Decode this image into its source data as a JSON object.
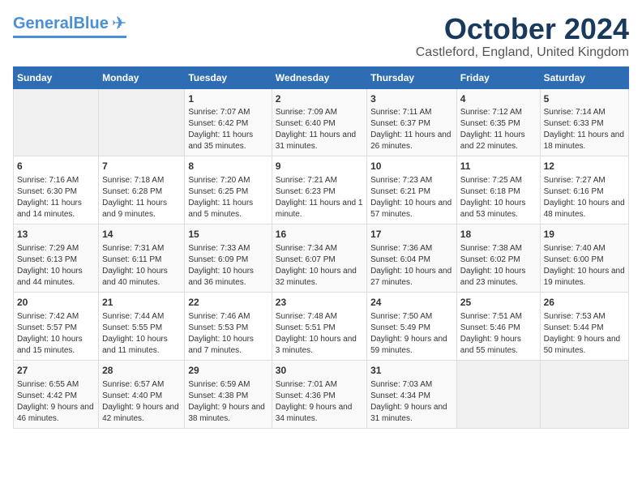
{
  "header": {
    "logo_general": "General",
    "logo_blue": "Blue",
    "month_title": "October 2024",
    "location": "Castleford, England, United Kingdom"
  },
  "days_of_week": [
    "Sunday",
    "Monday",
    "Tuesday",
    "Wednesday",
    "Thursday",
    "Friday",
    "Saturday"
  ],
  "weeks": [
    [
      {
        "day": "",
        "info": ""
      },
      {
        "day": "",
        "info": ""
      },
      {
        "day": "1",
        "info": "Sunrise: 7:07 AM\nSunset: 6:42 PM\nDaylight: 11 hours and 35 minutes."
      },
      {
        "day": "2",
        "info": "Sunrise: 7:09 AM\nSunset: 6:40 PM\nDaylight: 11 hours and 31 minutes."
      },
      {
        "day": "3",
        "info": "Sunrise: 7:11 AM\nSunset: 6:37 PM\nDaylight: 11 hours and 26 minutes."
      },
      {
        "day": "4",
        "info": "Sunrise: 7:12 AM\nSunset: 6:35 PM\nDaylight: 11 hours and 22 minutes."
      },
      {
        "day": "5",
        "info": "Sunrise: 7:14 AM\nSunset: 6:33 PM\nDaylight: 11 hours and 18 minutes."
      }
    ],
    [
      {
        "day": "6",
        "info": "Sunrise: 7:16 AM\nSunset: 6:30 PM\nDaylight: 11 hours and 14 minutes."
      },
      {
        "day": "7",
        "info": "Sunrise: 7:18 AM\nSunset: 6:28 PM\nDaylight: 11 hours and 9 minutes."
      },
      {
        "day": "8",
        "info": "Sunrise: 7:20 AM\nSunset: 6:25 PM\nDaylight: 11 hours and 5 minutes."
      },
      {
        "day": "9",
        "info": "Sunrise: 7:21 AM\nSunset: 6:23 PM\nDaylight: 11 hours and 1 minute."
      },
      {
        "day": "10",
        "info": "Sunrise: 7:23 AM\nSunset: 6:21 PM\nDaylight: 10 hours and 57 minutes."
      },
      {
        "day": "11",
        "info": "Sunrise: 7:25 AM\nSunset: 6:18 PM\nDaylight: 10 hours and 53 minutes."
      },
      {
        "day": "12",
        "info": "Sunrise: 7:27 AM\nSunset: 6:16 PM\nDaylight: 10 hours and 48 minutes."
      }
    ],
    [
      {
        "day": "13",
        "info": "Sunrise: 7:29 AM\nSunset: 6:13 PM\nDaylight: 10 hours and 44 minutes."
      },
      {
        "day": "14",
        "info": "Sunrise: 7:31 AM\nSunset: 6:11 PM\nDaylight: 10 hours and 40 minutes."
      },
      {
        "day": "15",
        "info": "Sunrise: 7:33 AM\nSunset: 6:09 PM\nDaylight: 10 hours and 36 minutes."
      },
      {
        "day": "16",
        "info": "Sunrise: 7:34 AM\nSunset: 6:07 PM\nDaylight: 10 hours and 32 minutes."
      },
      {
        "day": "17",
        "info": "Sunrise: 7:36 AM\nSunset: 6:04 PM\nDaylight: 10 hours and 27 minutes."
      },
      {
        "day": "18",
        "info": "Sunrise: 7:38 AM\nSunset: 6:02 PM\nDaylight: 10 hours and 23 minutes."
      },
      {
        "day": "19",
        "info": "Sunrise: 7:40 AM\nSunset: 6:00 PM\nDaylight: 10 hours and 19 minutes."
      }
    ],
    [
      {
        "day": "20",
        "info": "Sunrise: 7:42 AM\nSunset: 5:57 PM\nDaylight: 10 hours and 15 minutes."
      },
      {
        "day": "21",
        "info": "Sunrise: 7:44 AM\nSunset: 5:55 PM\nDaylight: 10 hours and 11 minutes."
      },
      {
        "day": "22",
        "info": "Sunrise: 7:46 AM\nSunset: 5:53 PM\nDaylight: 10 hours and 7 minutes."
      },
      {
        "day": "23",
        "info": "Sunrise: 7:48 AM\nSunset: 5:51 PM\nDaylight: 10 hours and 3 minutes."
      },
      {
        "day": "24",
        "info": "Sunrise: 7:50 AM\nSunset: 5:49 PM\nDaylight: 9 hours and 59 minutes."
      },
      {
        "day": "25",
        "info": "Sunrise: 7:51 AM\nSunset: 5:46 PM\nDaylight: 9 hours and 55 minutes."
      },
      {
        "day": "26",
        "info": "Sunrise: 7:53 AM\nSunset: 5:44 PM\nDaylight: 9 hours and 50 minutes."
      }
    ],
    [
      {
        "day": "27",
        "info": "Sunrise: 6:55 AM\nSunset: 4:42 PM\nDaylight: 9 hours and 46 minutes."
      },
      {
        "day": "28",
        "info": "Sunrise: 6:57 AM\nSunset: 4:40 PM\nDaylight: 9 hours and 42 minutes."
      },
      {
        "day": "29",
        "info": "Sunrise: 6:59 AM\nSunset: 4:38 PM\nDaylight: 9 hours and 38 minutes."
      },
      {
        "day": "30",
        "info": "Sunrise: 7:01 AM\nSunset: 4:36 PM\nDaylight: 9 hours and 34 minutes."
      },
      {
        "day": "31",
        "info": "Sunrise: 7:03 AM\nSunset: 4:34 PM\nDaylight: 9 hours and 31 minutes."
      },
      {
        "day": "",
        "info": ""
      },
      {
        "day": "",
        "info": ""
      }
    ]
  ]
}
